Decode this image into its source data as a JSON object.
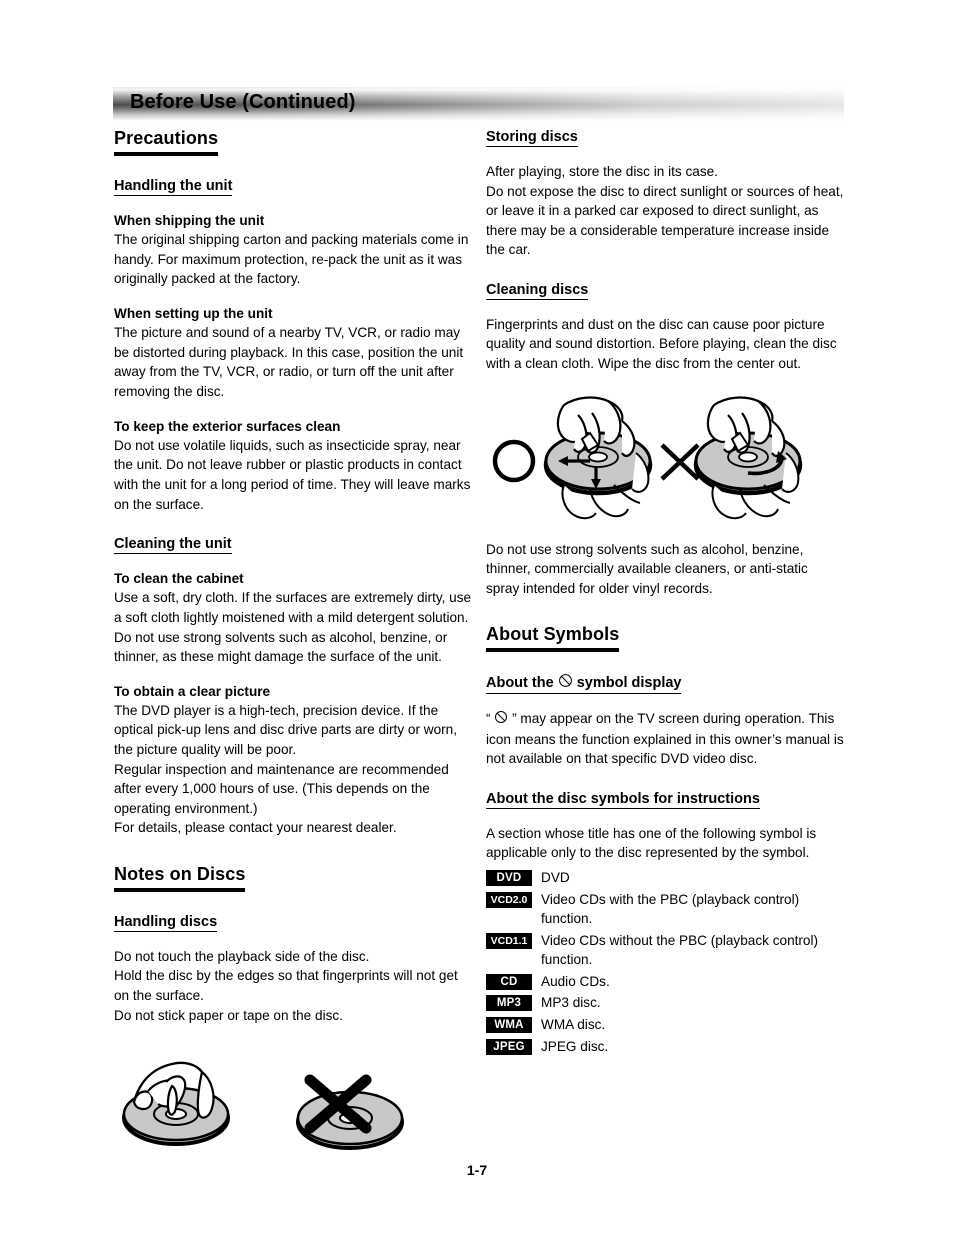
{
  "header": {
    "title": "Before Use (Continued)"
  },
  "footer": {
    "page_number": "1-7"
  },
  "left_column": {
    "section_title": "Precautions",
    "handling_unit": {
      "heading": "Handling the unit",
      "blocks": [
        {
          "title": "When shipping the unit",
          "text": "The original shipping carton and packing materials come in handy. For maximum protection, re-pack the unit as it was originally packed at the factory."
        },
        {
          "title": "When setting up the unit",
          "text": "The picture and sound of a nearby TV, VCR, or radio may be distorted during playback. In this case, position the unit away from the TV, VCR, or radio, or turn off the unit after removing the disc."
        },
        {
          "title": "To keep the exterior surfaces clean",
          "text": "Do not use volatile liquids, such as insecticide spray, near the unit. Do not leave rubber or plastic products in contact with the unit for a long period of time. They will leave marks on the surface."
        }
      ]
    },
    "cleaning_unit": {
      "heading": "Cleaning the unit",
      "blocks": [
        {
          "title": "To clean the cabinet",
          "text": "Use a soft, dry cloth. If the surfaces are extremely dirty, use a soft cloth lightly moistened with a mild detergent solution. Do not use strong solvents such as alcohol, benzine, or thinner, as these might damage the surface of the unit."
        },
        {
          "title": "To obtain a clear picture",
          "text": "The DVD player is a high-tech, precision device. If the optical pick-up lens and disc drive parts are dirty or worn, the picture quality will be poor.\nRegular inspection and maintenance are recommended after every 1,000 hours of use. (This depends on the operating environment.)\nFor details, please contact your nearest dealer."
        }
      ]
    },
    "notes_on_discs": {
      "section_title": "Notes on Discs",
      "handling_discs": {
        "heading": "Handling discs",
        "text": "Do not touch the playback side of the disc.\nHold the disc by the edges so that fingerprints will not get on the surface.\nDo not stick paper or tape on the disc."
      },
      "figure_alt": "hand-holding-disc-correct and disc-crossed-out-incorrect"
    }
  },
  "right_column": {
    "storing_discs": {
      "heading": "Storing discs",
      "text": "After playing, store the disc in its case.\nDo not expose the disc to direct sunlight or sources of heat, or leave it in a parked car exposed to direct sunlight, as there may be a considerable temperature increase inside the car."
    },
    "cleaning_discs": {
      "heading": "Cleaning discs",
      "text": "Fingerprints and dust on the disc can cause poor picture quality and sound distortion. Before playing, clean the disc with a clean cloth. Wipe the disc from the center out.",
      "figure_alt": "wipe-disc-center-out-correct and wipe-disc-circular-incorrect",
      "after_figure_text": "Do not use strong solvents such as alcohol, benzine, thinner, commercially available cleaners, or anti-static spray intended for older vinyl records."
    },
    "about_symbols": {
      "section_title": "About Symbols",
      "symbol_display": {
        "heading_before": "About the",
        "heading_after": "symbol display",
        "text_prefix": "“",
        "text_suffix": "” may appear on the TV screen during operation. This icon means the function explained in this owner’s manual is not available on that specific DVD video disc."
      },
      "disc_symbols": {
        "heading": "About the disc symbols for instructions",
        "intro": "A section whose title has one of the following symbol is applicable only to the disc represented by the symbol.",
        "rows": [
          {
            "badge": "DVD",
            "desc": "DVD"
          },
          {
            "badge": "VCD2.0",
            "desc": "Video CDs with the PBC (playback control) function."
          },
          {
            "badge": "VCD1.1",
            "desc": "Video CDs without the PBC (playback control) function."
          },
          {
            "badge": "CD",
            "desc": "Audio CDs."
          },
          {
            "badge": "MP3",
            "desc": "MP3 disc."
          },
          {
            "badge": "WMA",
            "desc": "WMA disc."
          },
          {
            "badge": "JPEG",
            "desc": "JPEG disc."
          }
        ]
      }
    }
  },
  "colors": {
    "text": "#000000",
    "badge_background": "#000000",
    "badge_text": "#ffffff",
    "disc_fill": "#c8c8c8",
    "page_background": "#ffffff"
  }
}
